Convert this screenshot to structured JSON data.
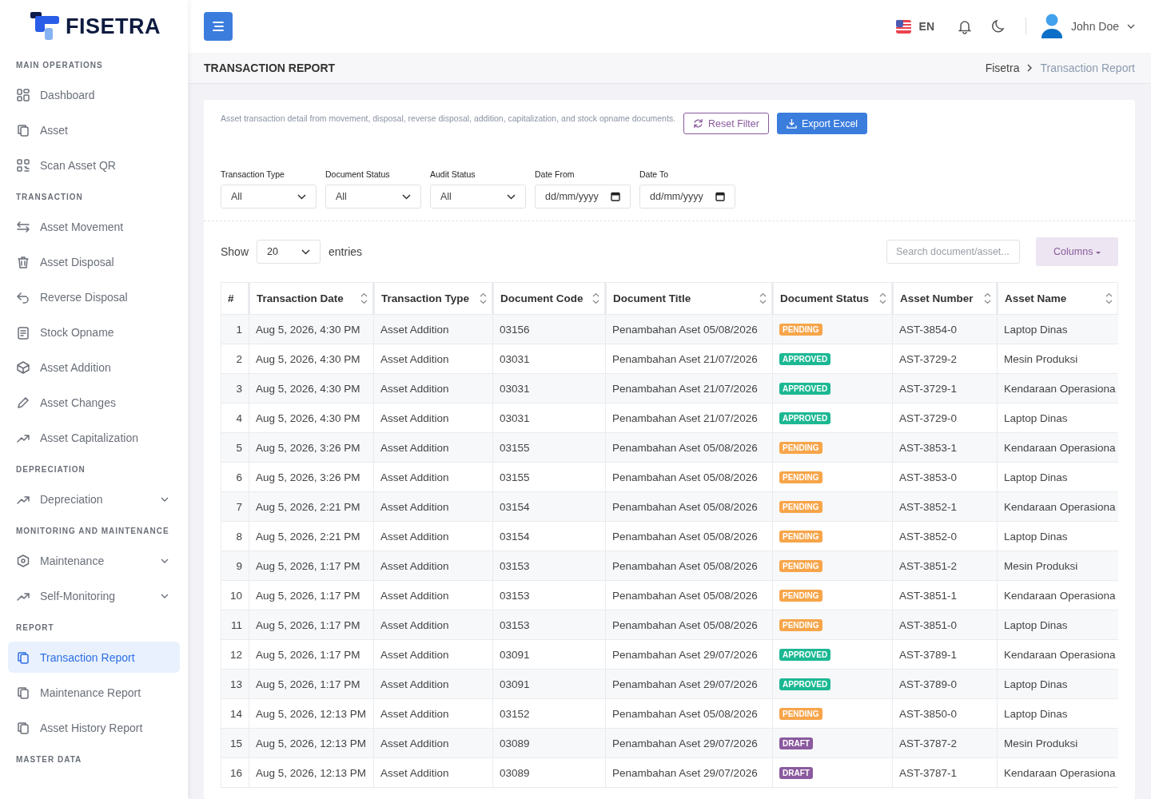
{
  "brand": {
    "name": "FISETRA"
  },
  "sidebar": {
    "sections": [
      {
        "title": "MAIN OPERATIONS",
        "items": [
          {
            "label": "Dashboard",
            "selected": false,
            "expandable": false
          },
          {
            "label": "Asset",
            "selected": false,
            "expandable": false
          },
          {
            "label": "Scan Asset QR",
            "selected": false,
            "expandable": false
          }
        ]
      },
      {
        "title": "TRANSACTION",
        "items": [
          {
            "label": "Asset Movement",
            "selected": false,
            "expandable": false
          },
          {
            "label": "Asset Disposal",
            "selected": false,
            "expandable": false
          },
          {
            "label": "Reverse Disposal",
            "selected": false,
            "expandable": false
          },
          {
            "label": "Stock Opname",
            "selected": false,
            "expandable": false
          },
          {
            "label": "Asset Addition",
            "selected": false,
            "expandable": false
          },
          {
            "label": "Asset Changes",
            "selected": false,
            "expandable": false
          },
          {
            "label": "Asset Capitalization",
            "selected": false,
            "expandable": false
          }
        ]
      },
      {
        "title": "DEPRECIATION",
        "items": [
          {
            "label": "Depreciation",
            "selected": false,
            "expandable": true
          }
        ]
      },
      {
        "title": "MONITORING AND MAINTENANCE",
        "items": [
          {
            "label": "Maintenance",
            "selected": false,
            "expandable": true
          },
          {
            "label": "Self-Monitoring",
            "selected": false,
            "expandable": true
          }
        ]
      },
      {
        "title": "REPORT",
        "items": [
          {
            "label": "Transaction Report",
            "selected": true,
            "expandable": false
          },
          {
            "label": "Maintenance Report",
            "selected": false,
            "expandable": false
          },
          {
            "label": "Asset History Report",
            "selected": false,
            "expandable": false
          }
        ]
      },
      {
        "title": "MASTER DATA"
      }
    ]
  },
  "topbar": {
    "language": "EN",
    "user": "John Doe"
  },
  "page": {
    "title": "TRANSACTION REPORT",
    "breadcrumb": [
      "Fisetra",
      "Transaction Report"
    ]
  },
  "report": {
    "description": "Asset transaction detail from movement, disposal, reverse disposal, addition, capitalization, and stock opname documents.",
    "reset_button": "Reset Filter",
    "export_button": "Export Excel",
    "filters": [
      {
        "label": "Transaction Type",
        "kind": "select",
        "value": "All"
      },
      {
        "label": "Document Status",
        "kind": "select",
        "value": "All"
      },
      {
        "label": "Audit Status",
        "kind": "select",
        "value": "All"
      },
      {
        "label": "Date From",
        "kind": "date",
        "value": "dd/mm/yyyy"
      },
      {
        "label": "Date To",
        "kind": "date",
        "value": "dd/mm/yyyy"
      }
    ],
    "show_label": "Show",
    "page_size": "20",
    "entries_label": "entries",
    "search": {
      "placeholder": "Search document/asset..."
    },
    "columns_button": "Columns"
  },
  "table": {
    "columns": [
      "#",
      "Transaction Date",
      "Transaction Type",
      "Document Code",
      "Document Title",
      "Document Status",
      "Asset Number",
      "Asset Name"
    ],
    "rows": [
      [
        "1",
        "Aug 5, 2026, 4:30 PM",
        "Asset Addition",
        "03156",
        "Penambahan Aset 05/08/2026",
        {
          "label": "PENDING",
          "color": "#f7a54a"
        },
        "AST-3854-0",
        "Laptop Dinas"
      ],
      [
        "2",
        "Aug 5, 2026, 4:30 PM",
        "Asset Addition",
        "03031",
        "Penambahan Aset 21/07/2026",
        {
          "label": "APPROVED",
          "color": "#1cb893"
        },
        "AST-3729-2",
        "Mesin Produksi"
      ],
      [
        "3",
        "Aug 5, 2026, 4:30 PM",
        "Asset Addition",
        "03031",
        "Penambahan Aset 21/07/2026",
        {
          "label": "APPROVED",
          "color": "#1cb893"
        },
        "AST-3729-1",
        "Kendaraan Operasiona"
      ],
      [
        "4",
        "Aug 5, 2026, 4:30 PM",
        "Asset Addition",
        "03031",
        "Penambahan Aset 21/07/2026",
        {
          "label": "APPROVED",
          "color": "#1cb893"
        },
        "AST-3729-0",
        "Laptop Dinas"
      ],
      [
        "5",
        "Aug 5, 2026, 3:26 PM",
        "Asset Addition",
        "03155",
        "Penambahan Aset 05/08/2026",
        {
          "label": "PENDING",
          "color": "#f7a54a"
        },
        "AST-3853-1",
        "Kendaraan Operasiona"
      ],
      [
        "6",
        "Aug 5, 2026, 3:26 PM",
        "Asset Addition",
        "03155",
        "Penambahan Aset 05/08/2026",
        {
          "label": "PENDING",
          "color": "#f7a54a"
        },
        "AST-3853-0",
        "Laptop Dinas"
      ],
      [
        "7",
        "Aug 5, 2026, 2:21 PM",
        "Asset Addition",
        "03154",
        "Penambahan Aset 05/08/2026",
        {
          "label": "PENDING",
          "color": "#f7a54a"
        },
        "AST-3852-1",
        "Kendaraan Operasiona"
      ],
      [
        "8",
        "Aug 5, 2026, 2:21 PM",
        "Asset Addition",
        "03154",
        "Penambahan Aset 05/08/2026",
        {
          "label": "PENDING",
          "color": "#f7a54a"
        },
        "AST-3852-0",
        "Laptop Dinas"
      ],
      [
        "9",
        "Aug 5, 2026, 1:17 PM",
        "Asset Addition",
        "03153",
        "Penambahan Aset 05/08/2026",
        {
          "label": "PENDING",
          "color": "#f7a54a"
        },
        "AST-3851-2",
        "Mesin Produksi"
      ],
      [
        "10",
        "Aug 5, 2026, 1:17 PM",
        "Asset Addition",
        "03153",
        "Penambahan Aset 05/08/2026",
        {
          "label": "PENDING",
          "color": "#f7a54a"
        },
        "AST-3851-1",
        "Kendaraan Operasiona"
      ],
      [
        "11",
        "Aug 5, 2026, 1:17 PM",
        "Asset Addition",
        "03153",
        "Penambahan Aset 05/08/2026",
        {
          "label": "PENDING",
          "color": "#f7a54a"
        },
        "AST-3851-0",
        "Laptop Dinas"
      ],
      [
        "12",
        "Aug 5, 2026, 1:17 PM",
        "Asset Addition",
        "03091",
        "Penambahan Aset 29/07/2026",
        {
          "label": "APPROVED",
          "color": "#1cb893"
        },
        "AST-3789-1",
        "Kendaraan Operasiona"
      ],
      [
        "13",
        "Aug 5, 2026, 1:17 PM",
        "Asset Addition",
        "03091",
        "Penambahan Aset 29/07/2026",
        {
          "label": "APPROVED",
          "color": "#1cb893"
        },
        "AST-3789-0",
        "Laptop Dinas"
      ],
      [
        "14",
        "Aug 5, 2026, 12:13 PM",
        "Asset Addition",
        "03152",
        "Penambahan Aset 05/08/2026",
        {
          "label": "PENDING",
          "color": "#f7a54a"
        },
        "AST-3850-0",
        "Laptop Dinas"
      ],
      [
        "15",
        "Aug 5, 2026, 12:13 PM",
        "Asset Addition",
        "03089",
        "Penambahan Aset 29/07/2026",
        {
          "label": "DRAFT",
          "color": "#8a5a9e"
        },
        "AST-3787-2",
        "Mesin Produksi"
      ],
      [
        "16",
        "Aug 5, 2026, 12:13 PM",
        "Asset Addition",
        "03089",
        "Penambahan Aset 29/07/2026",
        {
          "label": "DRAFT",
          "color": "#8a5a9e"
        },
        "AST-3787-1",
        "Kendaraan Operasiona"
      ]
    ]
  }
}
